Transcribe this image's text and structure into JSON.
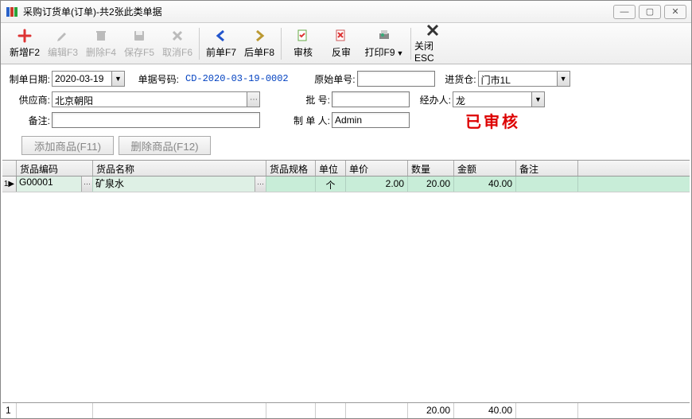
{
  "window": {
    "title": "采购订货单(订单)-共2张此类单据"
  },
  "toolbar": {
    "new": "新增F2",
    "edit": "编辑F3",
    "delete": "删除F4",
    "save": "保存F5",
    "cancel": "取消F6",
    "prev": "前单F7",
    "next": "后单F8",
    "audit": "审核",
    "unaudit": "反审",
    "print": "打印F9",
    "close": "关闭ESC"
  },
  "form": {
    "date_label": "制单日期:",
    "date_value": "2020-03-19",
    "docno_label": "单据号码:",
    "docno_value": "CD-2020-03-19-0002",
    "orig_label": "原始单号:",
    "orig_value": "",
    "warehouse_label": "进货仓:",
    "warehouse_value": "门市1L",
    "supplier_label": "供应商:",
    "supplier_value": "北京朝阳",
    "batch_label": "批    号:",
    "batch_value": "",
    "operator_label": "经办人:",
    "operator_value": "龙",
    "remark_label": "备注:",
    "remark_value": "",
    "maker_label": "制 单 人:",
    "maker_value": "Admin",
    "stamp": "已审核"
  },
  "buttons": {
    "add_item": "添加商品(F11)",
    "del_item": "删除商品(F12)"
  },
  "grid": {
    "headers": {
      "code": "货品编码",
      "name": "货品名称",
      "spec": "货品规格",
      "unit": "单位",
      "price": "单价",
      "qty": "数量",
      "amount": "金额",
      "remark": "备注"
    },
    "rows": [
      {
        "code": "G00001",
        "name": "矿泉水",
        "spec": "",
        "unit": "个",
        "price": "2.00",
        "qty": "20.00",
        "amount": "40.00",
        "remark": ""
      }
    ],
    "footer": {
      "rownum": "1",
      "qty": "20.00",
      "amount": "40.00"
    }
  },
  "cols": {
    "selector": 18,
    "code": 96,
    "name": 218,
    "spec": 62,
    "unit": 38,
    "price": 78,
    "qty": 58,
    "amount": 78,
    "remark": 78
  }
}
